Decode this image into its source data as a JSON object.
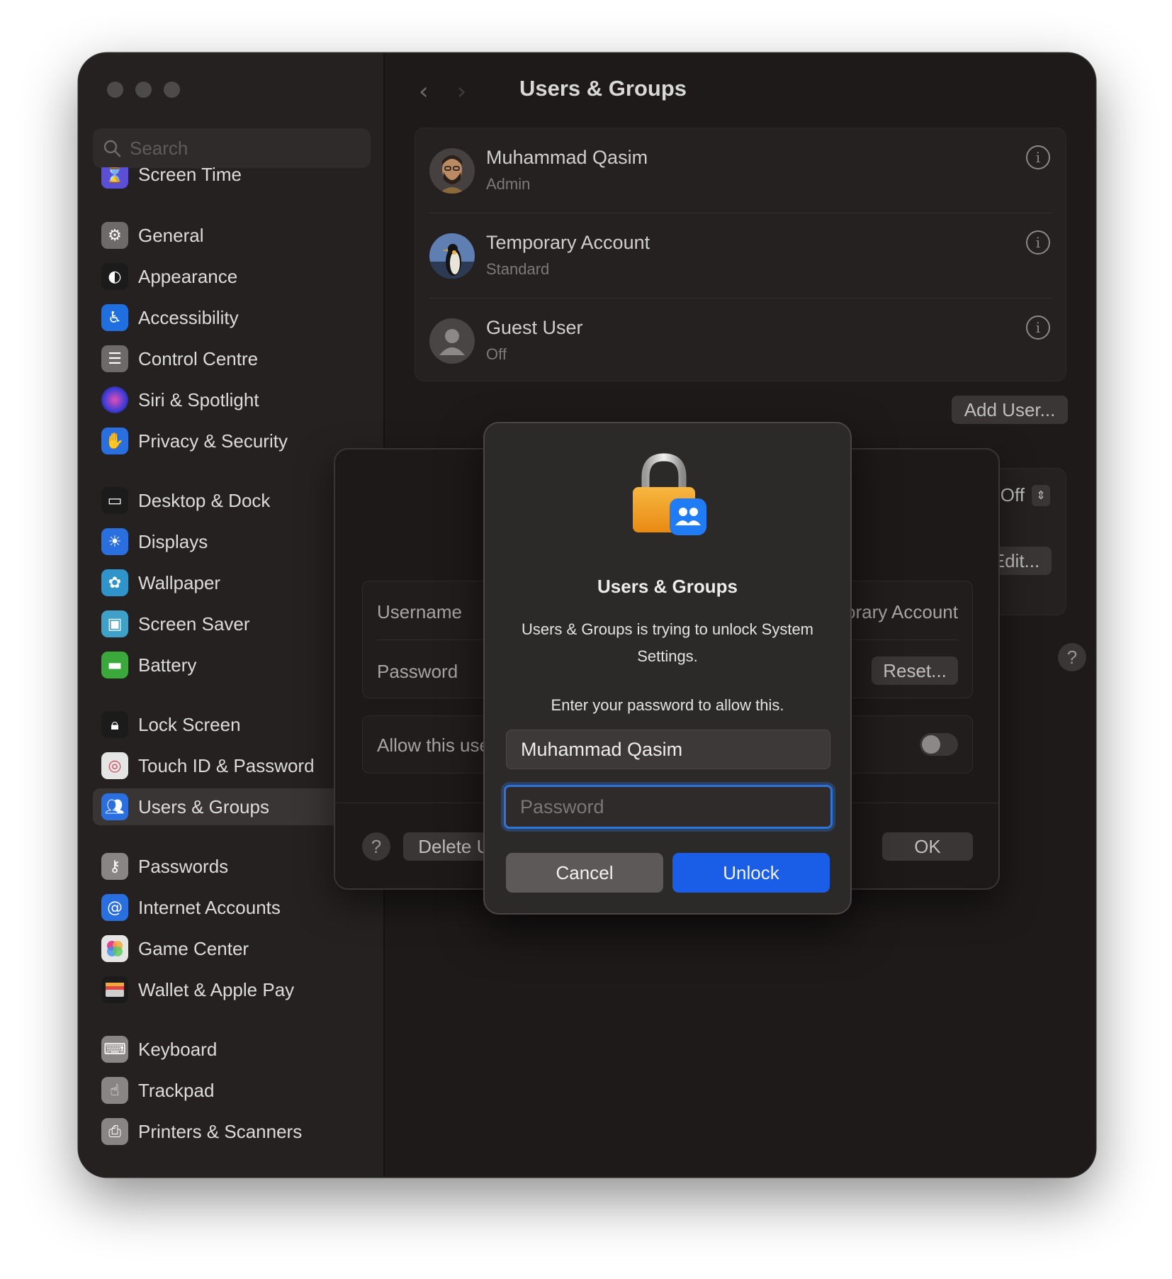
{
  "sidebar": {
    "search_placeholder": "Search",
    "items": [
      {
        "label": "Screen Time",
        "icon": "hourglass-icon",
        "color": "#5b4fd6"
      },
      {
        "label": "General",
        "icon": "gear-icon",
        "color": "#6e6a6a"
      },
      {
        "label": "Appearance",
        "icon": "appearance-icon",
        "color": "#1b1b1b"
      },
      {
        "label": "Accessibility",
        "icon": "accessibility-icon",
        "color": "#1f6fe0"
      },
      {
        "label": "Control Centre",
        "icon": "control-centre-icon",
        "color": "#6e6a6a"
      },
      {
        "label": "Siri & Spotlight",
        "icon": "siri-icon",
        "color": "#7a3db8"
      },
      {
        "label": "Privacy & Security",
        "icon": "hand-icon",
        "color": "#2a6fe0"
      },
      {
        "label": "Desktop & Dock",
        "icon": "desktop-icon",
        "color": "#1b1b1b"
      },
      {
        "label": "Displays",
        "icon": "sun-icon",
        "color": "#2a6fe0"
      },
      {
        "label": "Wallpaper",
        "icon": "flower-icon",
        "color": "#2f94c9"
      },
      {
        "label": "Screen Saver",
        "icon": "screen-saver-icon",
        "color": "#3fa0c8"
      },
      {
        "label": "Battery",
        "icon": "battery-icon",
        "color": "#3aa83a"
      },
      {
        "label": "Lock Screen",
        "icon": "lock-icon",
        "color": "#1b1b1b"
      },
      {
        "label": "Touch ID & Password",
        "icon": "fingerprint-icon",
        "color": "#e5e5e5"
      },
      {
        "label": "Users & Groups",
        "icon": "users-icon",
        "color": "#2a6fe0",
        "selected": true
      },
      {
        "label": "Passwords",
        "icon": "key-icon",
        "color": "#8a8585"
      },
      {
        "label": "Internet Accounts",
        "icon": "at-icon",
        "color": "#2a6fe0"
      },
      {
        "label": "Game Center",
        "icon": "game-center-icon",
        "color": "#e5e5e5"
      },
      {
        "label": "Wallet & Apple Pay",
        "icon": "wallet-icon",
        "color": "#1b1b1b"
      },
      {
        "label": "Keyboard",
        "icon": "keyboard-icon",
        "color": "#8a8585"
      },
      {
        "label": "Trackpad",
        "icon": "trackpad-icon",
        "color": "#8a8585"
      },
      {
        "label": "Printers & Scanners",
        "icon": "printer-icon",
        "color": "#8a8585"
      }
    ]
  },
  "main": {
    "title": "Users & Groups",
    "users": [
      {
        "name": "Muhammad Qasim",
        "role": "Admin",
        "avatar": "memoji-avatar"
      },
      {
        "name": "Temporary Account",
        "role": "Standard",
        "avatar": "penguin-avatar"
      },
      {
        "name": "Guest User",
        "role": "Off",
        "avatar": "generic-person-avatar"
      }
    ],
    "add_user_label": "Add User...",
    "auto_login_value": "Off",
    "edit_label": "Edit..."
  },
  "sheet": {
    "username_label": "Username",
    "username_value": "Temporary Account",
    "password_label": "Password",
    "reset_label": "Reset...",
    "allow_label": "Allow this user to administer this computer",
    "delete_label": "Delete User...",
    "ok_label": "OK"
  },
  "dialog": {
    "title": "Users & Groups",
    "message": "Users & Groups is trying to unlock System Settings.",
    "prompt": "Enter your password to allow this.",
    "username_value": "Muhammad Qasim",
    "password_placeholder": "Password",
    "cancel_label": "Cancel",
    "unlock_label": "Unlock",
    "accent": "#1a5ee8"
  }
}
